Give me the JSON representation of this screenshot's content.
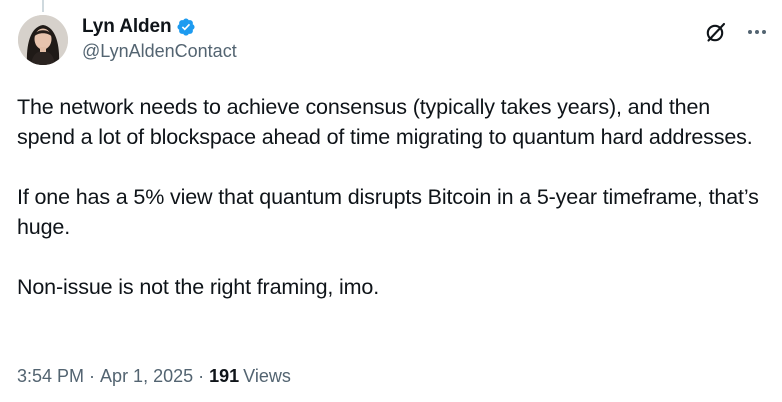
{
  "author": {
    "display_name": "Lyn Alden",
    "handle": "@LynAldenContact",
    "verified": true,
    "verified_color": "#1d9bf0"
  },
  "post": {
    "paragraphs": [
      "The network needs to achieve consensus (typically takes years), and then spend a lot of blockspace ahead of time migrating to quantum hard addresses.",
      "If one has a 5% view that quantum disrupts Bitcoin in a 5-year timeframe, that’s huge.",
      "Non-issue is not the right framing, imo."
    ]
  },
  "meta": {
    "time": "3:54 PM",
    "separator": "·",
    "date": "Apr 1, 2025",
    "views_count": "191",
    "views_label": "Views"
  },
  "icons": {
    "verified": "verified-badge-icon",
    "grok": "grok-icon",
    "more": "more-options-icon"
  },
  "colors": {
    "text_primary": "#0f1419",
    "text_secondary": "#536471",
    "accent": "#1d9bf0"
  }
}
